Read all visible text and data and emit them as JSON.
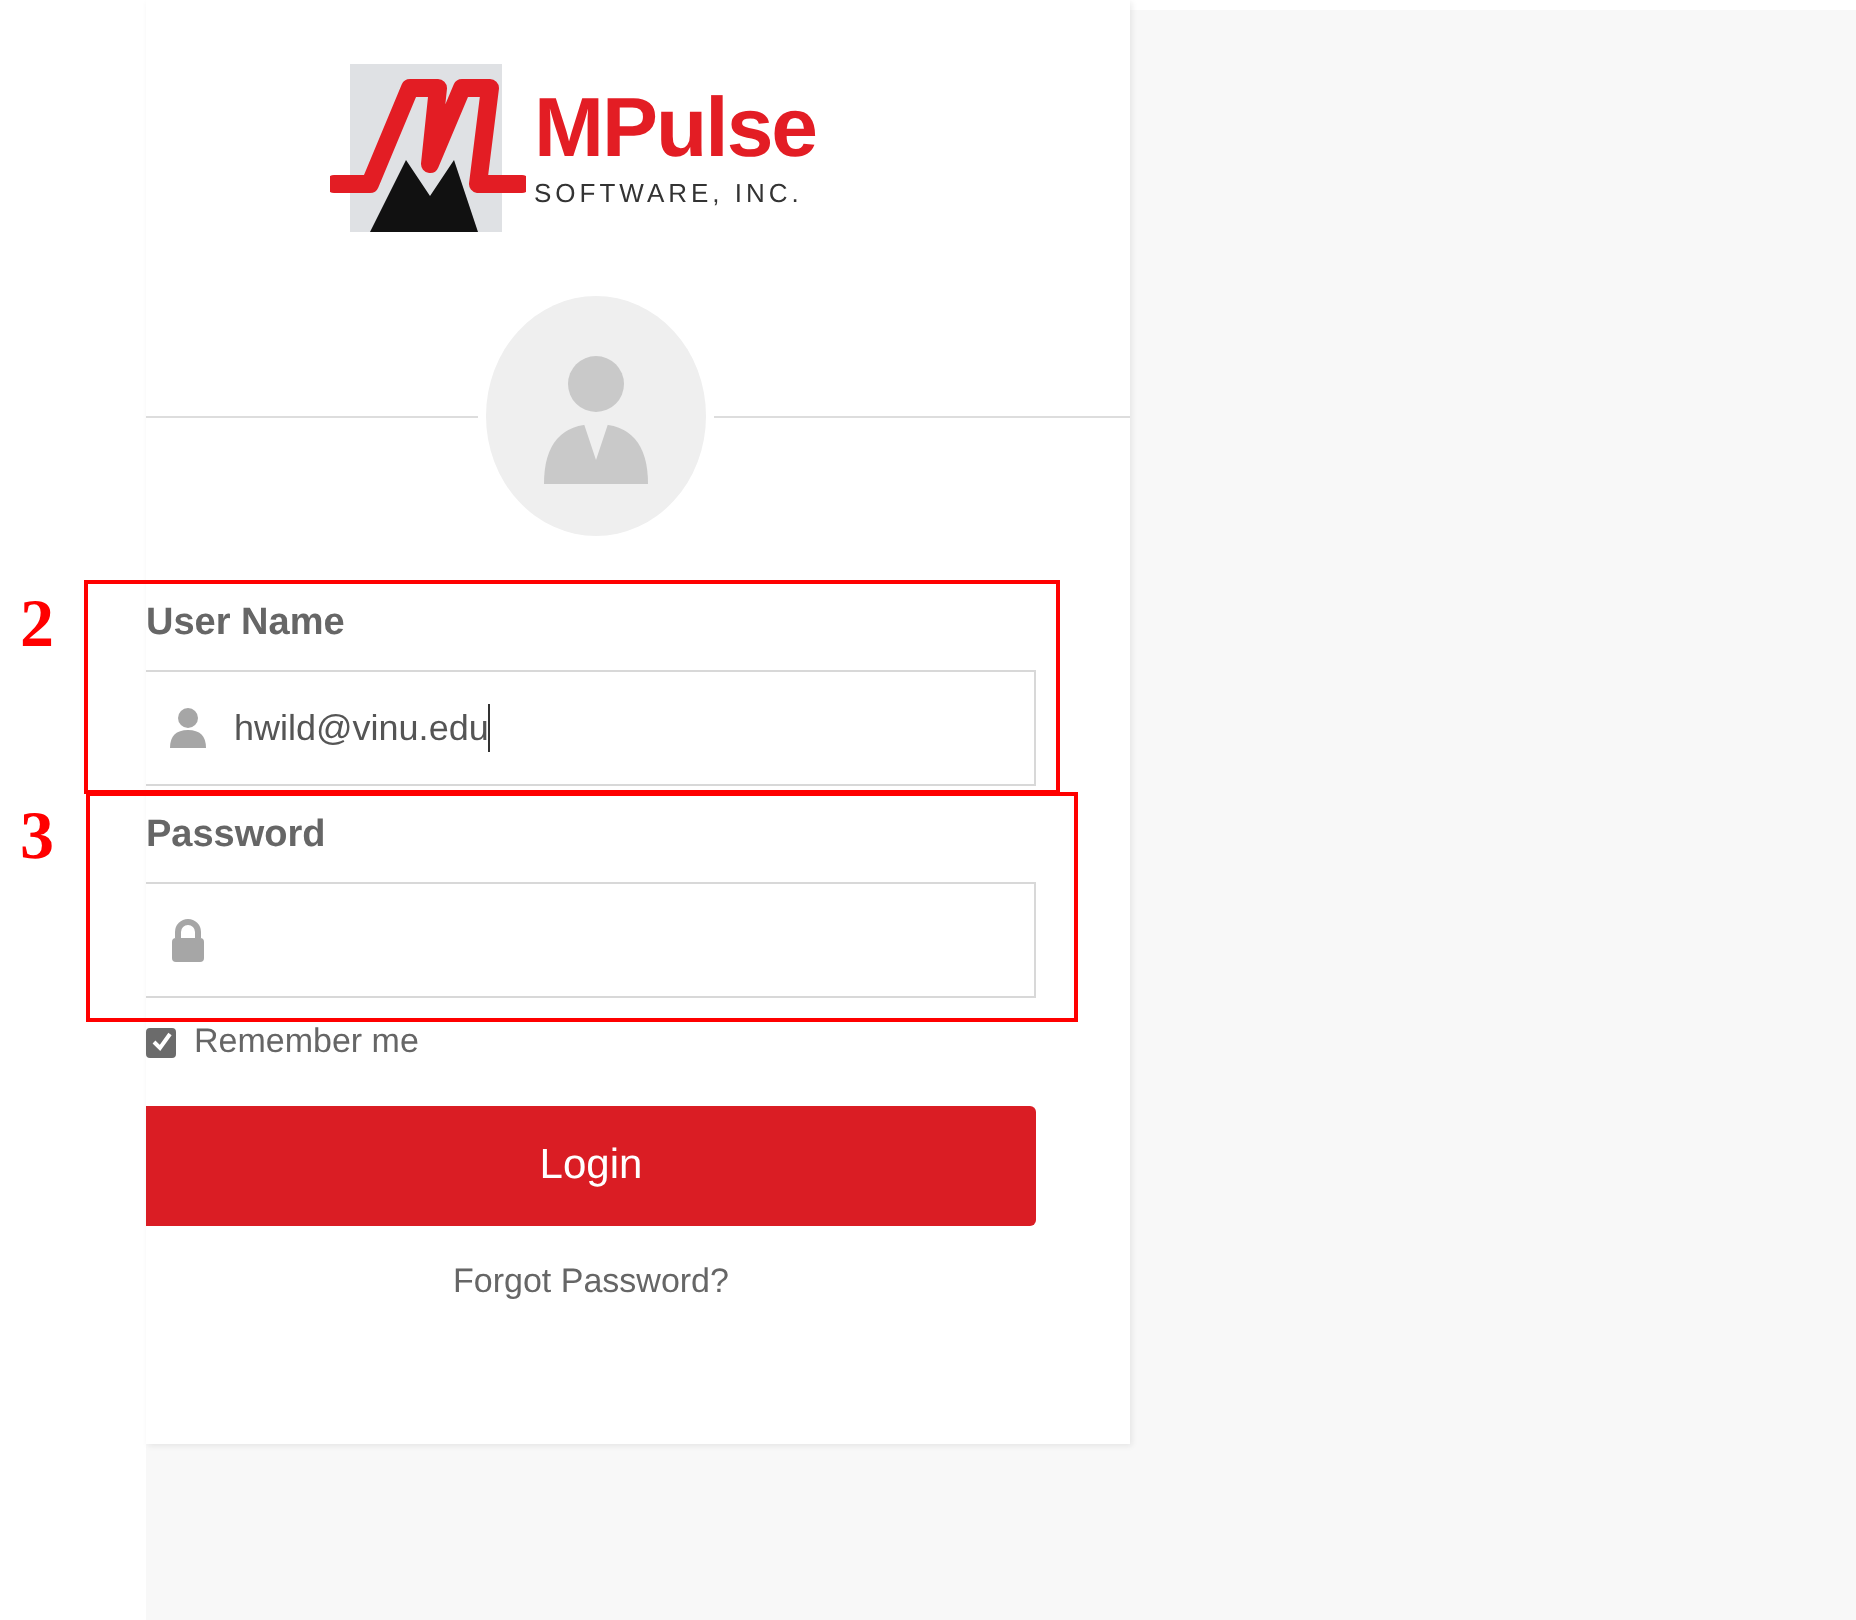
{
  "logo": {
    "name": "MPulse",
    "tagline": "SOFTWARE, INC."
  },
  "fields": [
    {
      "kind": "user",
      "label": "User Name",
      "value": "hwild@vinu.edu",
      "focused": true,
      "callout": "2"
    },
    {
      "kind": "password",
      "label": "Password",
      "focused": false,
      "callout": "3"
    }
  ],
  "remember": {
    "label": "Remember me",
    "checked": true
  },
  "login_button": "Login",
  "forgot_link": "Forgot Password?"
}
